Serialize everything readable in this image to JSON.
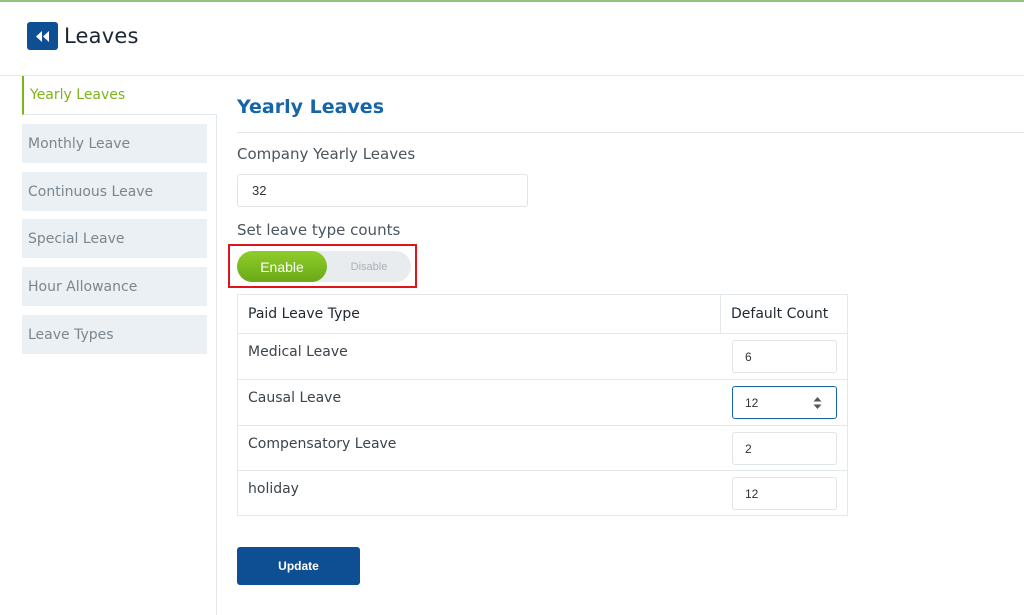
{
  "header": {
    "title": "Leaves",
    "back_icon": "double-chevron-left-icon"
  },
  "sidebar": {
    "items": [
      {
        "label": "Yearly Leaves",
        "active": true
      },
      {
        "label": "Monthly Leave",
        "active": false
      },
      {
        "label": "Continuous Leave",
        "active": false
      },
      {
        "label": "Special Leave",
        "active": false
      },
      {
        "label": "Hour Allowance",
        "active": false
      },
      {
        "label": "Leave Types",
        "active": false
      }
    ]
  },
  "main": {
    "title": "Yearly Leaves",
    "company_yearly_label": "Company Yearly Leaves",
    "company_yearly_value": "32",
    "leave_counts_label": "Set leave type counts",
    "toggle": {
      "enable_label": "Enable",
      "disable_label": "Disable",
      "state": "Enable"
    },
    "table": {
      "headers": {
        "type": "Paid Leave Type",
        "count": "Default Count"
      },
      "rows": [
        {
          "type": "Medical Leave",
          "count": "6"
        },
        {
          "type": "Causal Leave",
          "count": "12"
        },
        {
          "type": "Compensatory Leave",
          "count": "2"
        },
        {
          "type": "holiday",
          "count": "12"
        }
      ]
    },
    "update_label": "Update"
  },
  "colors": {
    "brand_blue": "#0e4f94",
    "title_blue": "#1565a8",
    "accent_green": "#7cb518",
    "highlight_red": "#e0151b"
  }
}
